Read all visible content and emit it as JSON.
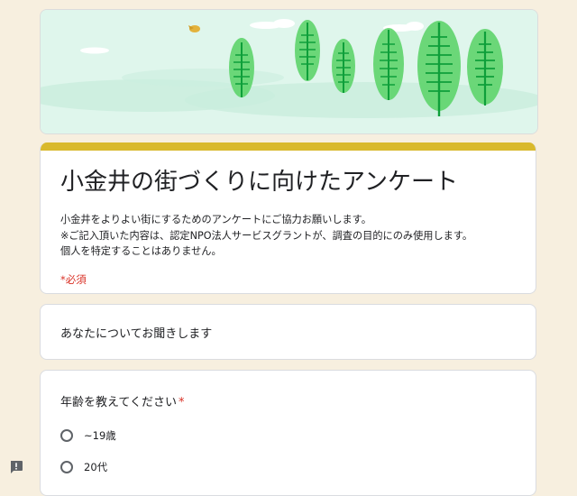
{
  "form": {
    "title": "小金井の街づくりに向けたアンケート",
    "description_lines": [
      "小金井をよりよい街にするためのアンケートにご協力お願いします。",
      "※ご記入頂いた内容は、認定NPO法人サービスグラントが、調査の目的にのみ使用します。",
      "個人を特定することはありません。"
    ],
    "required_note": "*必須",
    "accent_color": "#d9b92c"
  },
  "section": {
    "title": "あなたについてお聞きします"
  },
  "question": {
    "title": "年齢を教えてください",
    "required_mark": "*",
    "options": [
      "~19歳",
      "20代"
    ]
  },
  "icons": {
    "report": "report-problem-icon",
    "header": "forest-illustration"
  }
}
